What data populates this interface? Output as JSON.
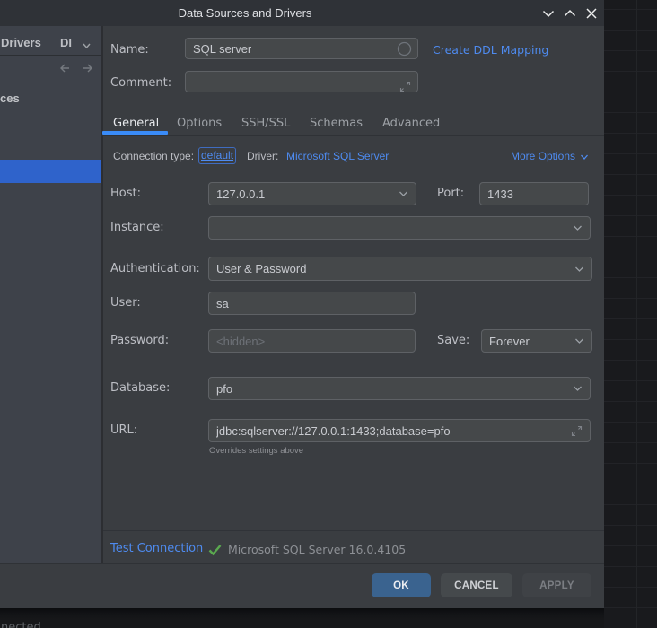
{
  "titlebar": {
    "title": "Data Sources and Drivers"
  },
  "sidebar": {
    "header_fragment": "Drivers",
    "header_dropdown_fragment": "DI",
    "section_fragment": "ces"
  },
  "header": {
    "name_label": "Name:",
    "name_value": "SQL server",
    "create_ddl_link": "Create DDL Mapping",
    "comment_label": "Comment:",
    "comment_value": ""
  },
  "tabs": [
    {
      "label": "General"
    },
    {
      "label": "Options"
    },
    {
      "label": "SSH/SSL"
    },
    {
      "label": "Schemas"
    },
    {
      "label": "Advanced"
    }
  ],
  "connection_row": {
    "type_label": "Connection type:",
    "type_value": "default",
    "driver_label": "Driver:",
    "driver_value": "Microsoft SQL Server",
    "more_options": "More Options"
  },
  "form": {
    "host_label": "Host:",
    "host_value": "127.0.0.1",
    "port_label": "Port:",
    "port_value": "1433",
    "instance_label": "Instance:",
    "instance_value": "",
    "auth_label": "Authentication:",
    "auth_value": "User & Password",
    "user_label": "User:",
    "user_value": "sa",
    "password_label": "Password:",
    "password_placeholder": "<hidden>",
    "save_label": "Save:",
    "save_value": "Forever",
    "database_label": "Database:",
    "database_value": "pfo",
    "url_label": "URL:",
    "url_value": "jdbc:sqlserver://127.0.0.1:1433;database=pfo",
    "url_hint": "Overrides settings above"
  },
  "test_row": {
    "test_connection": "Test Connection",
    "result": "Microsoft SQL Server 16.0.4105"
  },
  "buttons": {
    "ok": "OK",
    "cancel": "CANCEL",
    "apply": "APPLY"
  },
  "statusbar": {
    "fragment": "nected"
  },
  "colors": {
    "link_blue": "#4e8bf0",
    "accent_button_blue": "#3a638f",
    "selection_blue": "#2f63cb",
    "tab_underline_blue": "#3a8cf8",
    "success_green": "#57a64e",
    "dialog_bg": "#3a3d41",
    "sidebar_bg": "#3e424a",
    "titlebar_bg": "#2f3237"
  }
}
